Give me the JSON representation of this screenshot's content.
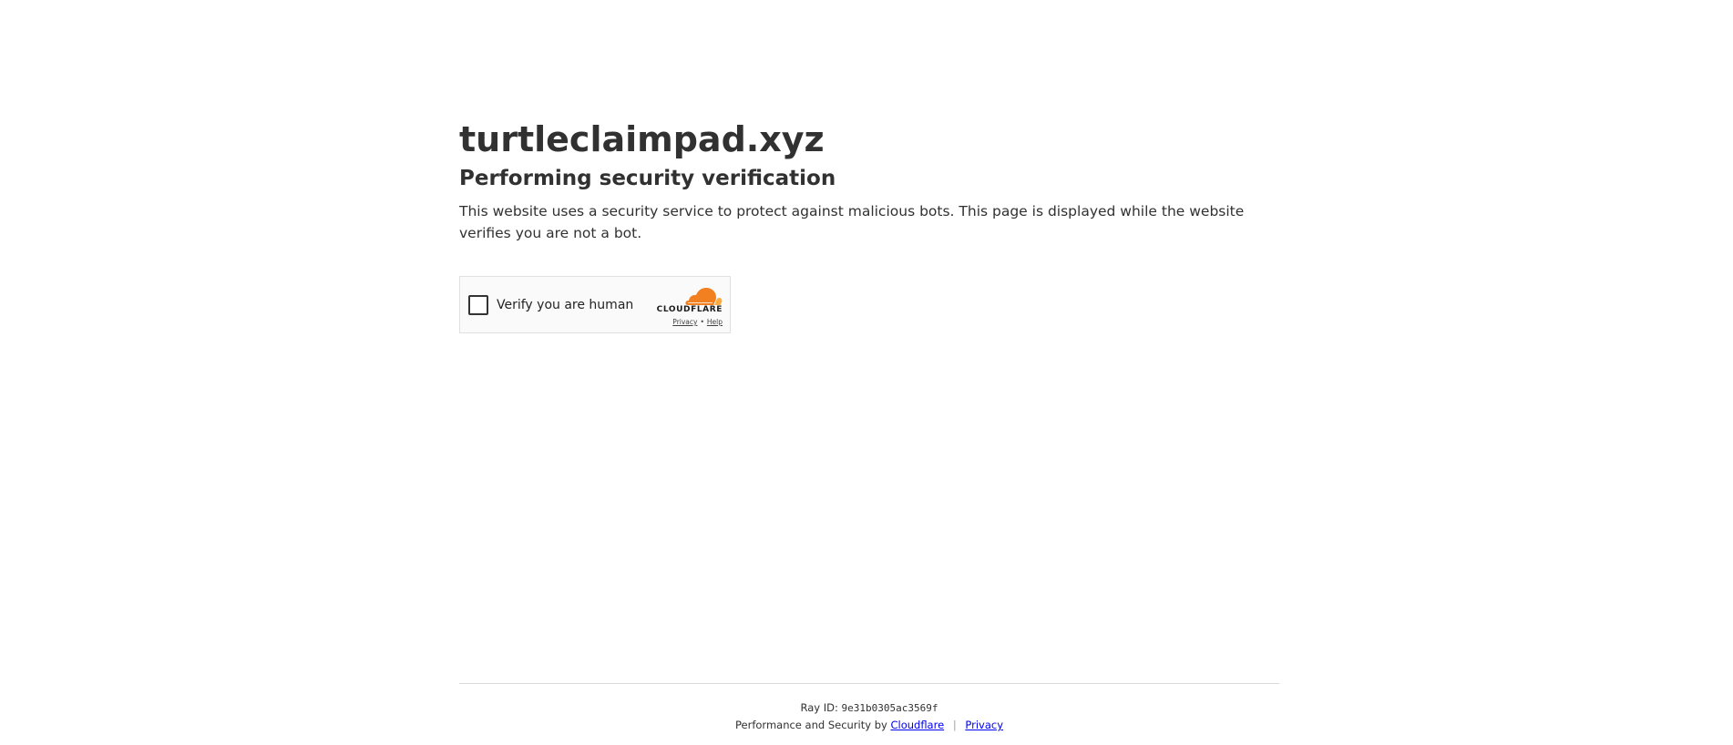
{
  "site": {
    "title": "turtleclaimpad.xyz"
  },
  "verification": {
    "heading": "Performing security verification",
    "description": "This website uses a security service to protect against malicious bots. This page is displayed while the website verifies you are not a bot."
  },
  "widget": {
    "checkbox_label": "Verify you are human",
    "brand": "CLOUDFLARE",
    "privacy_label": "Privacy",
    "separator": "•",
    "help_label": "Help",
    "brand_color": "#f38020",
    "brand_color_light": "#fbad41"
  },
  "footer": {
    "ray_label": "Ray ID:",
    "ray_value": "9e31b0305ac3569f",
    "performance_text": "Performance and Security by",
    "cloudflare_link": "Cloudflare",
    "separator": "|",
    "privacy_link": "Privacy"
  }
}
